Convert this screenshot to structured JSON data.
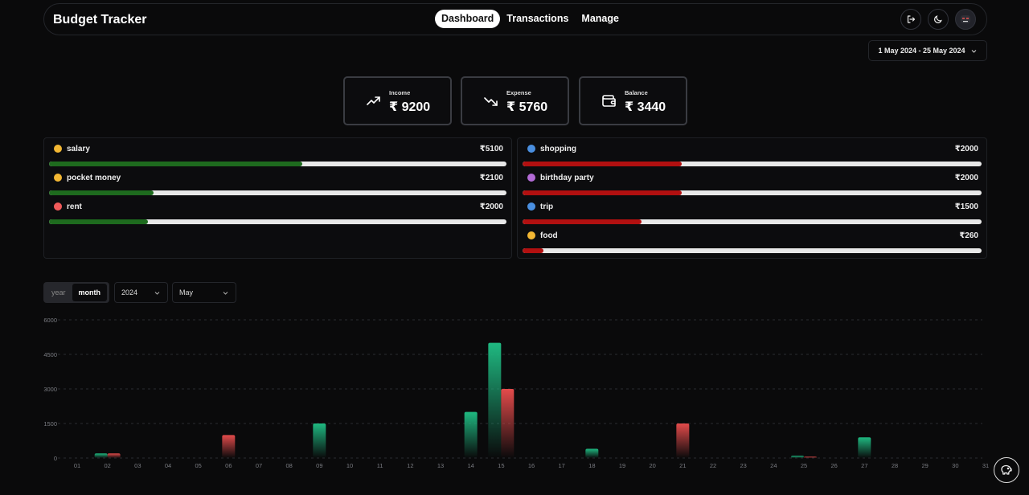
{
  "app": {
    "title": "Budget Tracker"
  },
  "nav": {
    "tabs": [
      {
        "label": "Dashboard",
        "active": true
      },
      {
        "label": "Transactions",
        "active": false
      },
      {
        "label": "Manage",
        "active": false
      }
    ],
    "icons": [
      "logout-icon",
      "moon-icon",
      "avatar-icon"
    ]
  },
  "date_range": {
    "label": "1 May 2024 - 25 May 2024"
  },
  "stats": {
    "income": {
      "label": "Income",
      "value": "₹ 9200"
    },
    "expense": {
      "label": "Expense",
      "value": "₹ 5760"
    },
    "balance": {
      "label": "Balance",
      "value": "₹ 3440"
    }
  },
  "income_categories": [
    {
      "name": "salary",
      "amount": "₹5100",
      "fraction": 0.554
    },
    {
      "name": "pocket money",
      "amount": "₹2100",
      "fraction": 0.228
    },
    {
      "name": "rent",
      "amount": "₹2000",
      "fraction": 0.217
    }
  ],
  "expense_categories": [
    {
      "name": "shopping",
      "amount": "₹2000",
      "fraction": 0.347
    },
    {
      "name": "birthday party",
      "amount": "₹2000",
      "fraction": 0.347
    },
    {
      "name": "trip",
      "amount": "₹1500",
      "fraction": 0.26
    },
    {
      "name": "food",
      "amount": "₹260",
      "fraction": 0.045
    }
  ],
  "controls": {
    "period_options": [
      "year",
      "month"
    ],
    "period_selected": "month",
    "year": "2024",
    "month": "May"
  },
  "colors": {
    "income": "#1fb981",
    "expense": "#e34b4b",
    "income_bar": "#1e6b1e",
    "expense_bar": "#b21010"
  },
  "chart_data": {
    "type": "bar",
    "categories": [
      "01",
      "02",
      "03",
      "04",
      "05",
      "06",
      "07",
      "08",
      "09",
      "10",
      "11",
      "12",
      "13",
      "14",
      "15",
      "16",
      "17",
      "18",
      "19",
      "20",
      "21",
      "22",
      "23",
      "24",
      "25",
      "26",
      "27",
      "28",
      "29",
      "30",
      "31"
    ],
    "series": [
      {
        "name": "income",
        "values": [
          0,
          200,
          0,
          0,
          0,
          0,
          0,
          0,
          1500,
          0,
          0,
          0,
          0,
          2000,
          5000,
          0,
          0,
          400,
          0,
          0,
          0,
          0,
          0,
          0,
          100,
          0,
          900,
          0,
          0,
          0,
          0
        ]
      },
      {
        "name": "expense",
        "values": [
          0,
          200,
          0,
          0,
          0,
          1000,
          0,
          0,
          0,
          0,
          0,
          0,
          0,
          0,
          3000,
          0,
          0,
          0,
          0,
          0,
          1500,
          0,
          0,
          0,
          60,
          0,
          0,
          0,
          0,
          0,
          0
        ]
      }
    ],
    "y_ticks": [
      "0",
      "1500",
      "3000",
      "4500",
      "6000"
    ],
    "ylim": [
      0,
      6000
    ],
    "grid": true
  }
}
